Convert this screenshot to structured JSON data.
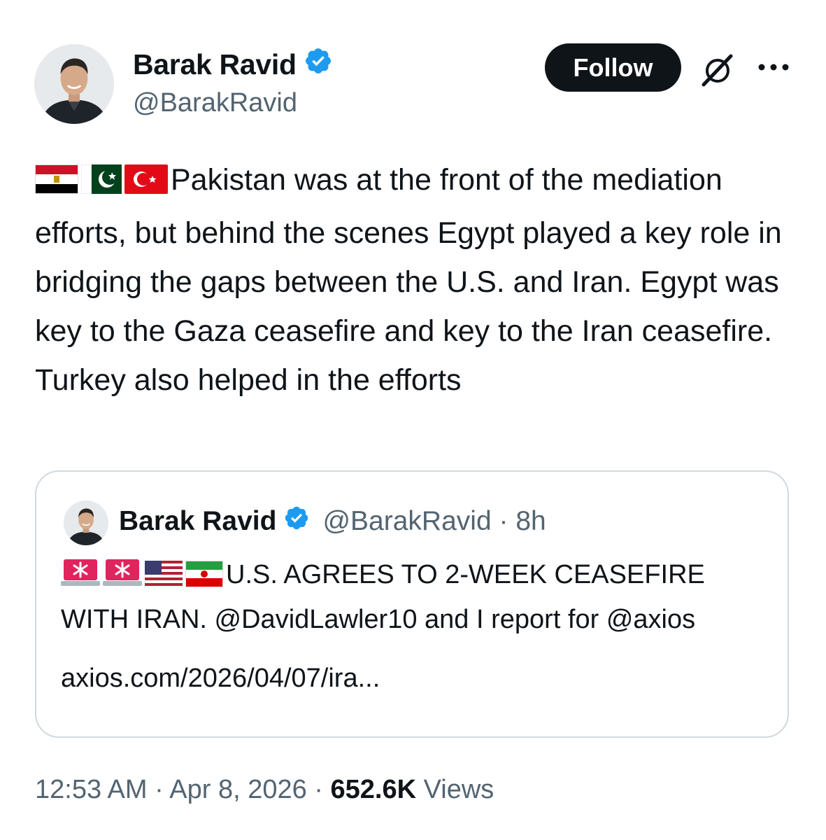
{
  "author": {
    "name": "Barak Ravid",
    "handle": "@BarakRavid",
    "verified": true
  },
  "actions": {
    "follow_label": "Follow",
    "grok_icon": "grok-slash-circle-icon",
    "more_icon": "more-horizontal-icon"
  },
  "tweet": {
    "flags": [
      "flag-egypt",
      "flag-pakistan",
      "flag-turkey"
    ],
    "text": "Pakistan was at the front of the mediation efforts, but behind the scenes Egypt played a key role in bridging the gaps between the U.S. and Iran. Egypt was key to the Gaza ceasefire and key to the Iran ceasefire. Turkey also helped in the efforts"
  },
  "quote": {
    "name": "Barak Ravid",
    "handle": "@BarakRavid",
    "separator": "·",
    "age": "8h",
    "emojis": [
      "rotating-light",
      "rotating-light",
      "flag-united-states",
      "flag-iran"
    ],
    "text": "U.S. AGREES TO 2-WEEK CEASEFIRE WITH IRAN. @DavidLawler10 and I report for @axios",
    "link": "axios.com/2026/04/07/ira..."
  },
  "footer": {
    "time": "12:53 AM",
    "date": "Apr 8, 2026",
    "separator": "·",
    "views_count": "652.6K",
    "views_label": "Views"
  },
  "colors": {
    "text_primary": "#0f1419",
    "text_secondary": "#536471",
    "verified_blue": "#1d9bf0",
    "border": "#cfd9de",
    "follow_bg": "#0f1419"
  }
}
